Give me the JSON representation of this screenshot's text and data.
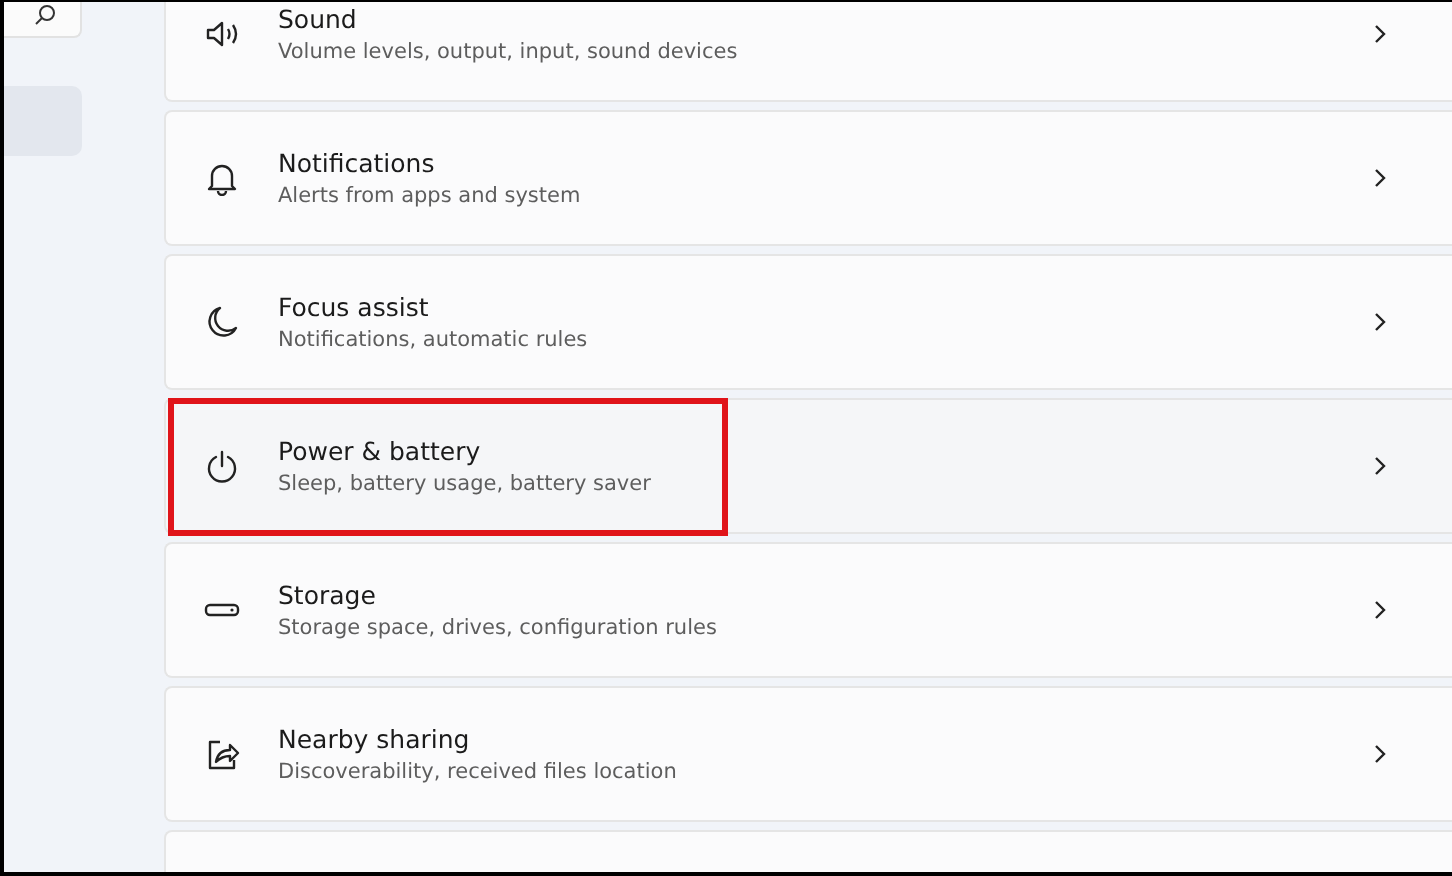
{
  "sidebar": {
    "items": [
      {
        "selected": true
      }
    ]
  },
  "settings": [
    {
      "kind": "setting",
      "title": "Sound",
      "subtitle": "Volume levels, output, input, sound devices",
      "highlighted": false
    },
    {
      "kind": "setting",
      "title": "Notifications",
      "subtitle": "Alerts from apps and system",
      "highlighted": false
    },
    {
      "kind": "setting",
      "title": "Focus assist",
      "subtitle": "Notifications, automatic rules",
      "highlighted": false
    },
    {
      "kind": "setting",
      "title": "Power & battery",
      "subtitle": "Sleep, battery usage, battery saver",
      "highlighted": true
    },
    {
      "kind": "setting",
      "title": "Storage",
      "subtitle": "Storage space, drives, configuration rules",
      "highlighted": false
    },
    {
      "kind": "setting",
      "title": "Nearby sharing",
      "subtitle": "Discoverability, received files location",
      "highlighted": false
    },
    {
      "kind": "cut"
    }
  ]
}
